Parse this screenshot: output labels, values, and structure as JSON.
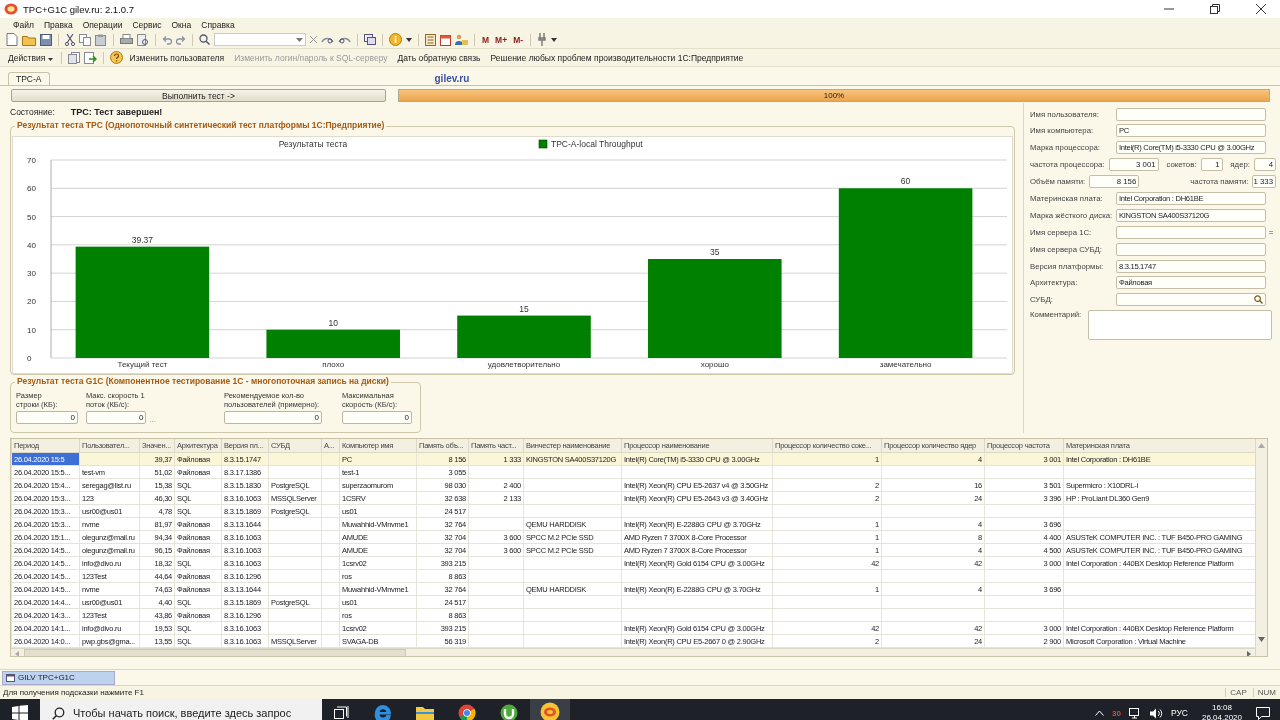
{
  "window": {
    "title": "TPC+G1C gilev.ru: 2.1.0.7"
  },
  "menu": [
    "Файл",
    "Правка",
    "Операции",
    "Сервис",
    "Окна",
    "Справка"
  ],
  "toolbar": {
    "memory_buttons": [
      "M",
      "M+",
      "M-"
    ]
  },
  "actions": {
    "menu": "Действия",
    "links": [
      {
        "label": "Изменить пользователя",
        "disabled": false
      },
      {
        "label": "Изменить логин/пароль к SQL-серверу",
        "disabled": true
      },
      {
        "label": "Дать обратную связь",
        "disabled": false
      },
      {
        "label": "Решение любых проблем производительности 1С:Предприятие",
        "disabled": false
      }
    ]
  },
  "tabs": [
    {
      "label": "TPC-A",
      "selected": true
    }
  ],
  "site_label": "gilev.ru",
  "run_button": "Выполнить тест ->",
  "progress": {
    "level": 1,
    "reading": "100%"
  },
  "state": {
    "label": "Состояние:",
    "value": "TPC: Тест завершен!"
  },
  "tpc_group": {
    "title": "Результат теста TPC (Однопоточный синтетический тест платформы 1С:Предприятие)",
    "chart_data": {
      "type": "bar",
      "title": "Результаты теста",
      "categories": [
        "Текущий тест",
        "плохо",
        "удовлетворительно",
        "хорошо",
        "замечательно"
      ],
      "series": [
        {
          "name": "TPC-A-local Throughput",
          "color": "#008000",
          "values": [
            39.37,
            10,
            15,
            35,
            60
          ]
        }
      ],
      "ylim": [
        0,
        70
      ],
      "grid": true,
      "yticks": [
        0,
        10,
        20,
        30,
        40,
        50,
        60,
        70
      ],
      "data_labels": true
    }
  },
  "g1c_group": {
    "title": "Результат теста G1C (Компонентное тестирование 1С - многопоточная запись на диски)",
    "fields": [
      {
        "label": "Размер строки (КБ):",
        "value": "0"
      },
      {
        "label": "Макс. скорость 1 поток (КБ/с):",
        "value": "0",
        "button": "..."
      },
      {
        "label": "Рекомендуемое кол-во пользователей (примерно):",
        "value": "0"
      },
      {
        "label": "Максимальная скорость (КБ/с):",
        "value": "0"
      }
    ]
  },
  "info_panel": {
    "rows": [
      {
        "kind": "text",
        "label": "Имя пользователя:"
      },
      {
        "kind": "text",
        "label": "Имя компьютера:",
        "value": "PC"
      },
      {
        "kind": "text",
        "label": "Марка процессора:",
        "value": "Intel(R) Core(TM) i5-3330 CPU @ 3.00GHz"
      },
      {
        "kind": "numbers",
        "items": [
          {
            "label": "частота процессора:",
            "value": "3 001"
          },
          {
            "label": "сокетов:",
            "value": "1"
          },
          {
            "label": "ядер:",
            "value": "4"
          }
        ]
      },
      {
        "kind": "numbers",
        "items": [
          {
            "label": "Объём памяти:",
            "value": "8 156"
          },
          {
            "label": "частота памяти:",
            "value": "1 333"
          }
        ]
      },
      {
        "kind": "text",
        "label": "Материнская плата:",
        "value": "Intel Corporation : DH61BE"
      },
      {
        "kind": "text",
        "label": "Марка жёсткого диска:",
        "value": "KINGSTON SA400S37120G"
      },
      {
        "kind": "text",
        "label": "Имя сервера 1С:",
        "suffix": "="
      },
      {
        "kind": "text",
        "label": "Имя сервера СУБД:"
      },
      {
        "kind": "text",
        "label": "Версия платформы:",
        "value": "8.3.15.1747"
      },
      {
        "kind": "text",
        "label": "Архитектура:",
        "value": "Файловая"
      },
      {
        "kind": "lookup",
        "label": "СУБД:"
      },
      {
        "kind": "memo",
        "label": "Комментарий:"
      }
    ]
  },
  "table": {
    "columns": [
      "Период",
      "Пользовател...",
      "Значен...",
      "Архитектура",
      "Версия пл...",
      "СУБД",
      "А...",
      "Компьютер имя",
      "Память объ...",
      "Память част...",
      "Винчестер наименование",
      "Процессор наименование",
      "Процессор количество соке...",
      "Процессор количество ядер",
      "Процессор частота",
      "Материнская плата"
    ],
    "rows": [
      {
        "selected": true,
        "cells": [
          "26.04.2020 15:5",
          null,
          "39,37",
          "Файловая",
          "8.3.15.1747",
          null,
          null,
          "PC",
          "8 156",
          "1 333",
          "KINGSTON SA400S37120G",
          "Intel(R) Core(TM) i5-3330 CPU @ 3.00GHz",
          "1",
          "4",
          "3 001",
          "Intel Corporation : DH61BE"
        ]
      },
      {
        "selected": false,
        "cells": [
          "26.04.2020 15:5...",
          "test-vm",
          "51,02",
          "Файловая",
          "8.3.17.1386",
          null,
          null,
          "test-1",
          "3 055",
          null,
          null,
          null,
          null,
          null,
          null,
          null
        ]
      },
      {
        "selected": false,
        "cells": [
          "26.04.2020 15:4...",
          "seregag@list.ru",
          "15,38",
          "SQL",
          "8.3.15.1830",
          "PostgreSQL",
          null,
          "superzaomurom",
          "98 030",
          "2 400",
          null,
          "Intel(R) Xeon(R) CPU E5-2637 v4 @ 3.50GHz",
          "2",
          "16",
          "3 501",
          "Supermicro : X10DRL-i"
        ]
      },
      {
        "selected": false,
        "cells": [
          "26.04.2020 15:3...",
          "123",
          "46,30",
          "SQL",
          "8.3.16.1063",
          "MSSQLServer",
          null,
          "1CSRV",
          "32 638",
          "2 133",
          null,
          "Intel(R) Xeon(R) CPU E5-2643 v3 @ 3.40GHz",
          "2",
          "24",
          "3 396",
          "HP : ProLiant DL360 Gen9"
        ]
      },
      {
        "selected": false,
        "cells": [
          "26.04.2020 15:3...",
          "usr00@us01",
          "4,78",
          "SQL",
          "8.3.15.1869",
          "PostgreSQL",
          null,
          "us01",
          "24 517",
          null,
          null,
          null,
          null,
          null,
          null,
          null
        ]
      },
      {
        "selected": false,
        "cells": [
          "26.04.2020 15:3...",
          "nvme",
          "81,97",
          "Файловая",
          "8.3.13.1644",
          null,
          null,
          "Muwahhid-VMnvme1",
          "32 764",
          null,
          "QEMU HARDDISK",
          "Intel(R) Xeon(R) E-2288G CPU @ 3.70GHz",
          "1",
          "4",
          "3 696",
          null
        ]
      },
      {
        "selected": false,
        "cells": [
          "26.04.2020 15:1...",
          "olegunz@mail.ru",
          "94,34",
          "Файловая",
          "8.3.16.1063",
          null,
          null,
          "AMUDE",
          "32 704",
          "3 600",
          "SPCC M.2 PCIe SSD",
          "AMD Ryzen 7 3700X 8-Core Processor",
          "1",
          "8",
          "4 400",
          "ASUSTeK COMPUTER INC. : TUF B450-PRO GAMING"
        ]
      },
      {
        "selected": false,
        "cells": [
          "26.04.2020 14:5...",
          "olegunz@mail.ru",
          "96,15",
          "Файловая",
          "8.3.16.1063",
          null,
          null,
          "AMUDE",
          "32 704",
          "3 600",
          "SPCC M.2 PCIe SSD",
          "AMD Ryzen 7 3700X 8-Core Processor",
          "1",
          "4",
          "4 500",
          "ASUSTeK COMPUTER INC. : TUF B450-PRO GAMING"
        ]
      },
      {
        "selected": false,
        "cells": [
          "26.04.2020 14:5...",
          "info@divo.ru",
          "18,32",
          "SQL",
          "8.3.16.1063",
          null,
          null,
          "1csrv02",
          "393 215",
          null,
          null,
          "Intel(R) Xeon(R) Gold 6154 CPU @ 3.00GHz",
          "42",
          "42",
          "3 000",
          "Intel Corporation : 440BX Desktop Reference Platform"
        ]
      },
      {
        "selected": false,
        "cells": [
          "26.04.2020 14:5...",
          "123Test",
          "44,64",
          "Файловая",
          "8.3.16.1296",
          null,
          null,
          "ros",
          "8 863",
          null,
          null,
          null,
          null,
          null,
          null,
          null
        ]
      },
      {
        "selected": false,
        "cells": [
          "26.04.2020 14:5...",
          "nvme",
          "74,63",
          "Файловая",
          "8.3.13.1644",
          null,
          null,
          "Muwahhid-VMnvme1",
          "32 764",
          null,
          "QEMU HARDDISK",
          "Intel(R) Xeon(R) E-2288G CPU @ 3.70GHz",
          "1",
          "4",
          "3 696",
          null
        ]
      },
      {
        "selected": false,
        "cells": [
          "26.04.2020 14:4...",
          "usr00@us01",
          "4,40",
          "SQL",
          "8.3.15.1869",
          "PostgreSQL",
          null,
          "us01",
          "24 517",
          null,
          null,
          null,
          null,
          null,
          null,
          null
        ]
      },
      {
        "selected": false,
        "cells": [
          "26.04.2020 14:3...",
          "123Test",
          "43,86",
          "Файловая",
          "8.3.16.1296",
          null,
          null,
          "ros",
          "8 863",
          null,
          null,
          null,
          null,
          null,
          null,
          null
        ]
      },
      {
        "selected": false,
        "cells": [
          "26.04.2020 14:1...",
          "info@divo.ru",
          "19,53",
          "SQL",
          "8.3.16.1063",
          null,
          null,
          "1csrv02",
          "393 215",
          null,
          null,
          "Intel(R) Xeon(R) Gold 6154 CPU @ 3.00GHz",
          "42",
          "42",
          "3 000",
          "Intel Corporation : 440BX Desktop Reference Platform"
        ]
      },
      {
        "selected": false,
        "cells": [
          "26.04.2020 14:0...",
          "pwp.gbs@gma...",
          "13,55",
          "SQL",
          "8.3.16.1063",
          "MSSQLServer",
          null,
          "SVAGA-DB",
          "56 319",
          null,
          null,
          "Intel(R) Xeon(R) CPU E5-2667 0 @ 2.90GHz",
          "2",
          "24",
          "2 900",
          "Microsoft Corporation : Virtual Machine"
        ]
      }
    ]
  },
  "window_tabs": [
    {
      "label": "GILV TPC+G1C",
      "selected": true
    }
  ],
  "status_bar": {
    "hint": "Для получения подсказки нажмите F1",
    "indicators": [
      "CAP",
      "NUM"
    ]
  },
  "taskbar": {
    "search_placeholder": "Чтобы начать поиск, введите здесь запрос",
    "tray_badge": "30",
    "language": "РУС",
    "time": "16:08",
    "date": "26.04.2020"
  }
}
